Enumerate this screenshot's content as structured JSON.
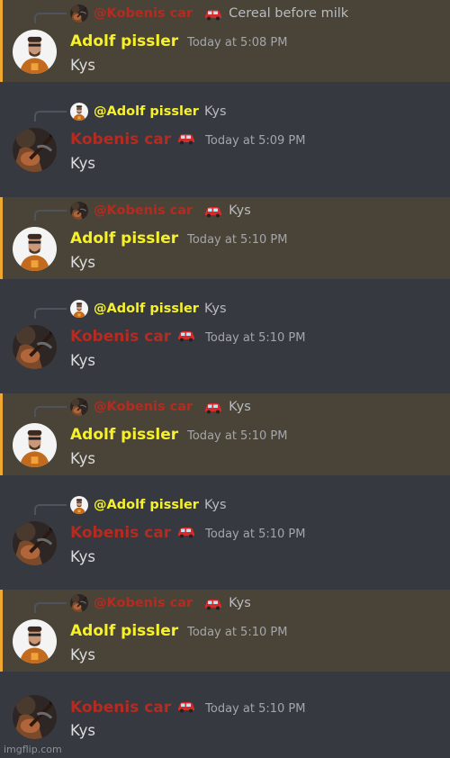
{
  "app": "Discord",
  "colors": {
    "background": "#36393f",
    "highlight_bg": "#494437",
    "highlight_bar": "#f0a830",
    "name_yellow": "#f7f12a",
    "name_red": "#b32b21"
  },
  "messages": [
    {
      "author": "Adolf pissler",
      "author_color": "yellow",
      "avatar": "gordon-avatar",
      "timestamp": "Today at 5:08 PM",
      "content": "Kys",
      "highlighted": true,
      "reply": {
        "mention": "@Kobenis car",
        "mention_color": "red",
        "avatar": "guitar-avatar",
        "has_car": true,
        "text": "Cereal before milk"
      }
    },
    {
      "author": "Kobenis car",
      "author_color": "red",
      "avatar": "guitar-avatar",
      "has_car": true,
      "timestamp": "Today at 5:09 PM",
      "content": "Kys",
      "highlighted": false,
      "reply": {
        "mention": "@Adolf pissler",
        "mention_color": "yellow",
        "avatar": "gordon-avatar",
        "has_car": false,
        "text": "Kys"
      }
    },
    {
      "author": "Adolf pissler",
      "author_color": "yellow",
      "avatar": "gordon-avatar",
      "timestamp": "Today at 5:10 PM",
      "content": "Kys",
      "highlighted": true,
      "reply": {
        "mention": "@Kobenis car",
        "mention_color": "red",
        "avatar": "guitar-avatar",
        "has_car": true,
        "text": "Kys"
      }
    },
    {
      "author": "Kobenis car",
      "author_color": "red",
      "avatar": "guitar-avatar",
      "has_car": true,
      "timestamp": "Today at 5:10 PM",
      "content": "Kys",
      "highlighted": false,
      "reply": {
        "mention": "@Adolf pissler",
        "mention_color": "yellow",
        "avatar": "gordon-avatar",
        "has_car": false,
        "text": "Kys"
      }
    },
    {
      "author": "Adolf pissler",
      "author_color": "yellow",
      "avatar": "gordon-avatar",
      "timestamp": "Today at 5:10 PM",
      "content": "Kys",
      "highlighted": true,
      "reply": {
        "mention": "@Kobenis car",
        "mention_color": "red",
        "avatar": "guitar-avatar",
        "has_car": true,
        "text": "Kys"
      }
    },
    {
      "author": "Kobenis car",
      "author_color": "red",
      "avatar": "guitar-avatar",
      "has_car": true,
      "timestamp": "Today at 5:10 PM",
      "content": "Kys",
      "highlighted": false,
      "reply": {
        "mention": "@Adolf pissler",
        "mention_color": "yellow",
        "avatar": "gordon-avatar",
        "has_car": false,
        "text": "Kys"
      }
    },
    {
      "author": "Adolf pissler",
      "author_color": "yellow",
      "avatar": "gordon-avatar",
      "timestamp": "Today at 5:10 PM",
      "content": "Kys",
      "highlighted": true,
      "reply": {
        "mention": "@Kobenis car",
        "mention_color": "red",
        "avatar": "guitar-avatar",
        "has_car": true,
        "text": "Kys"
      }
    },
    {
      "author": "Kobenis car",
      "author_color": "red",
      "avatar": "guitar-avatar",
      "has_car": true,
      "timestamp": "Today at 5:10 PM",
      "content": "Kys",
      "highlighted": false,
      "reply": null
    }
  ],
  "watermark": "imgflip.com"
}
